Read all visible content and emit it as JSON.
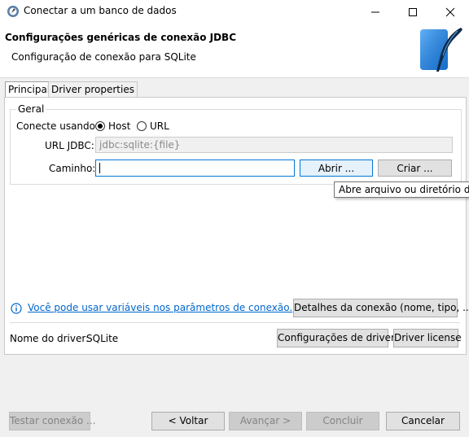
{
  "window": {
    "title": "Conectar a um banco de dados",
    "controls": [
      "minimize",
      "maximize",
      "close"
    ]
  },
  "header": {
    "title": "Configurações genéricas de conexão JDBC",
    "subtitle": "Configuração de conexão para SQLite",
    "logo_icon": "sqlite-feather-logo"
  },
  "tabs": [
    {
      "label": "Principal",
      "active": true
    },
    {
      "label": "Driver properties",
      "active": false
    }
  ],
  "general": {
    "legend": "Geral",
    "connect_using_label": "Conecte usando:",
    "options": [
      {
        "label": "Host",
        "selected": true
      },
      {
        "label": "URL",
        "selected": false
      }
    ],
    "jdbc_url_label": "URL JDBC:",
    "jdbc_url_value": "jdbc:sqlite:{file}",
    "path_label": "Caminho:",
    "path_value": "",
    "open_button": "Abrir ...",
    "create_button": "Criar ..."
  },
  "tooltip": "Abre arquivo ou diretório de banco de dados",
  "info": {
    "icon": "info-icon",
    "link_text": "Você pode usar variáveis nos parâmetros de conexão.",
    "details_button": "Detalhes da conexão (nome, tipo, ...)"
  },
  "driver": {
    "label": "Nome do driver:",
    "name": "SQLite",
    "settings_button": "Configurações de driver",
    "license_button": "Driver license"
  },
  "footer": {
    "test_button": "Testar conexão ...",
    "back_button": "< Voltar",
    "next_button": "Avançar >",
    "finish_button": "Concluir",
    "cancel_button": "Cancelar"
  },
  "colors": {
    "accent": "#0078d7",
    "link": "#0066cc",
    "logo_blue": "#1e88e5"
  }
}
